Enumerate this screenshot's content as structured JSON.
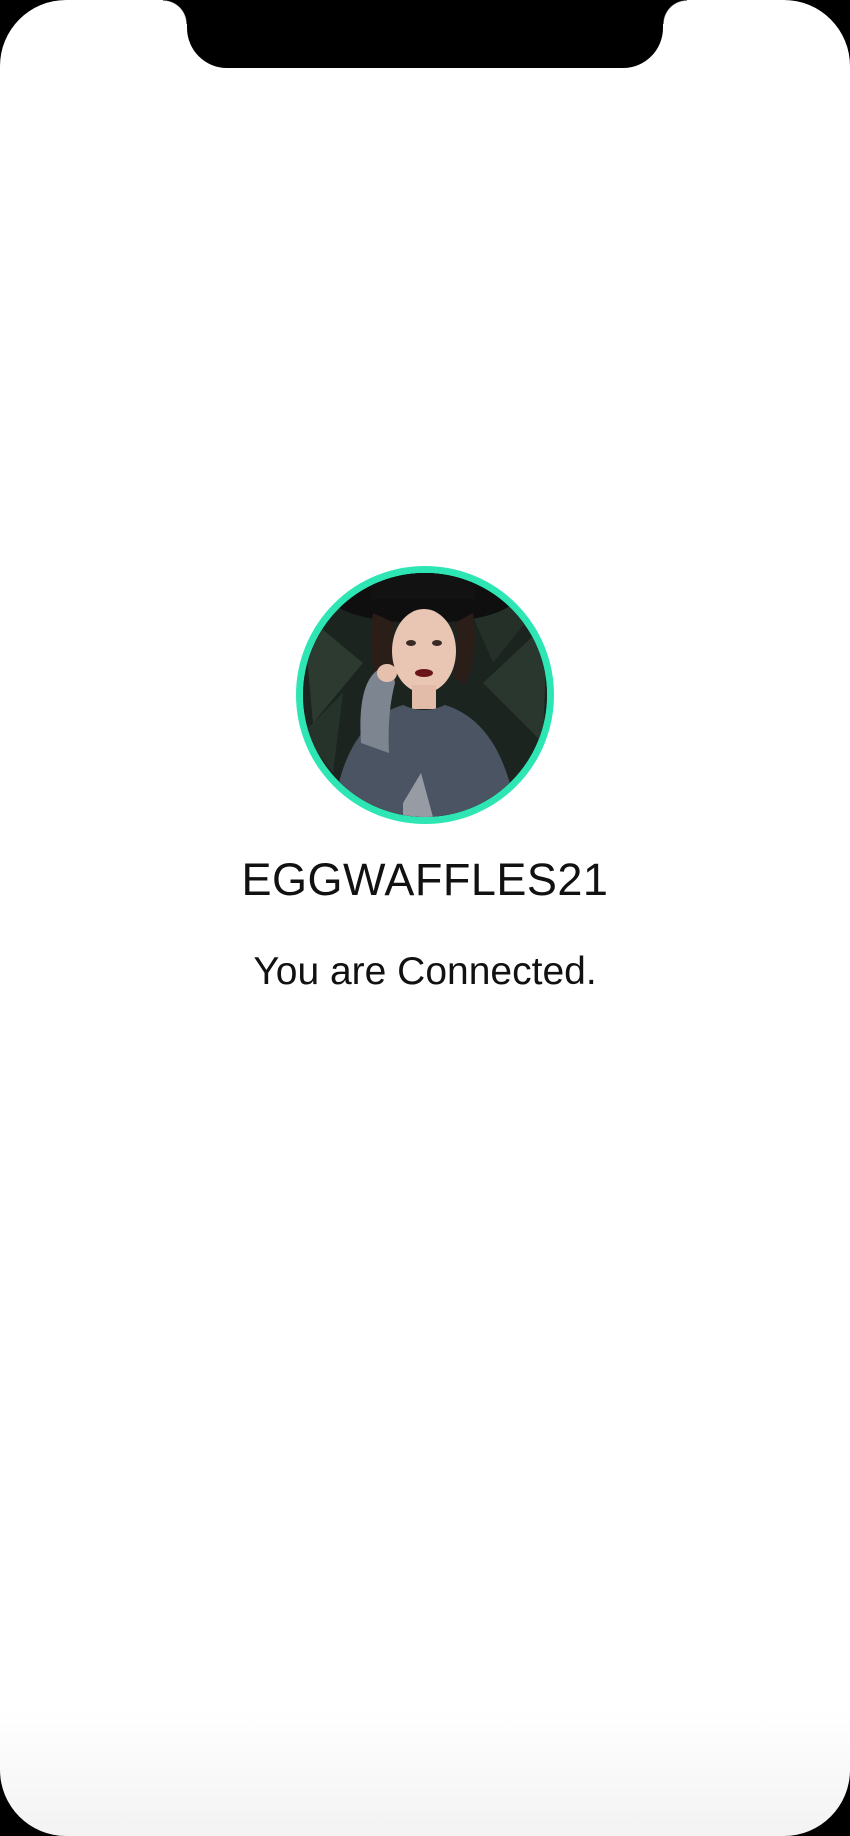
{
  "profile": {
    "username": "EGGWAFFLES21",
    "status_message": "You are Connected.",
    "avatar_icon": "user-photo",
    "accent_color": "#2ee6b4"
  }
}
